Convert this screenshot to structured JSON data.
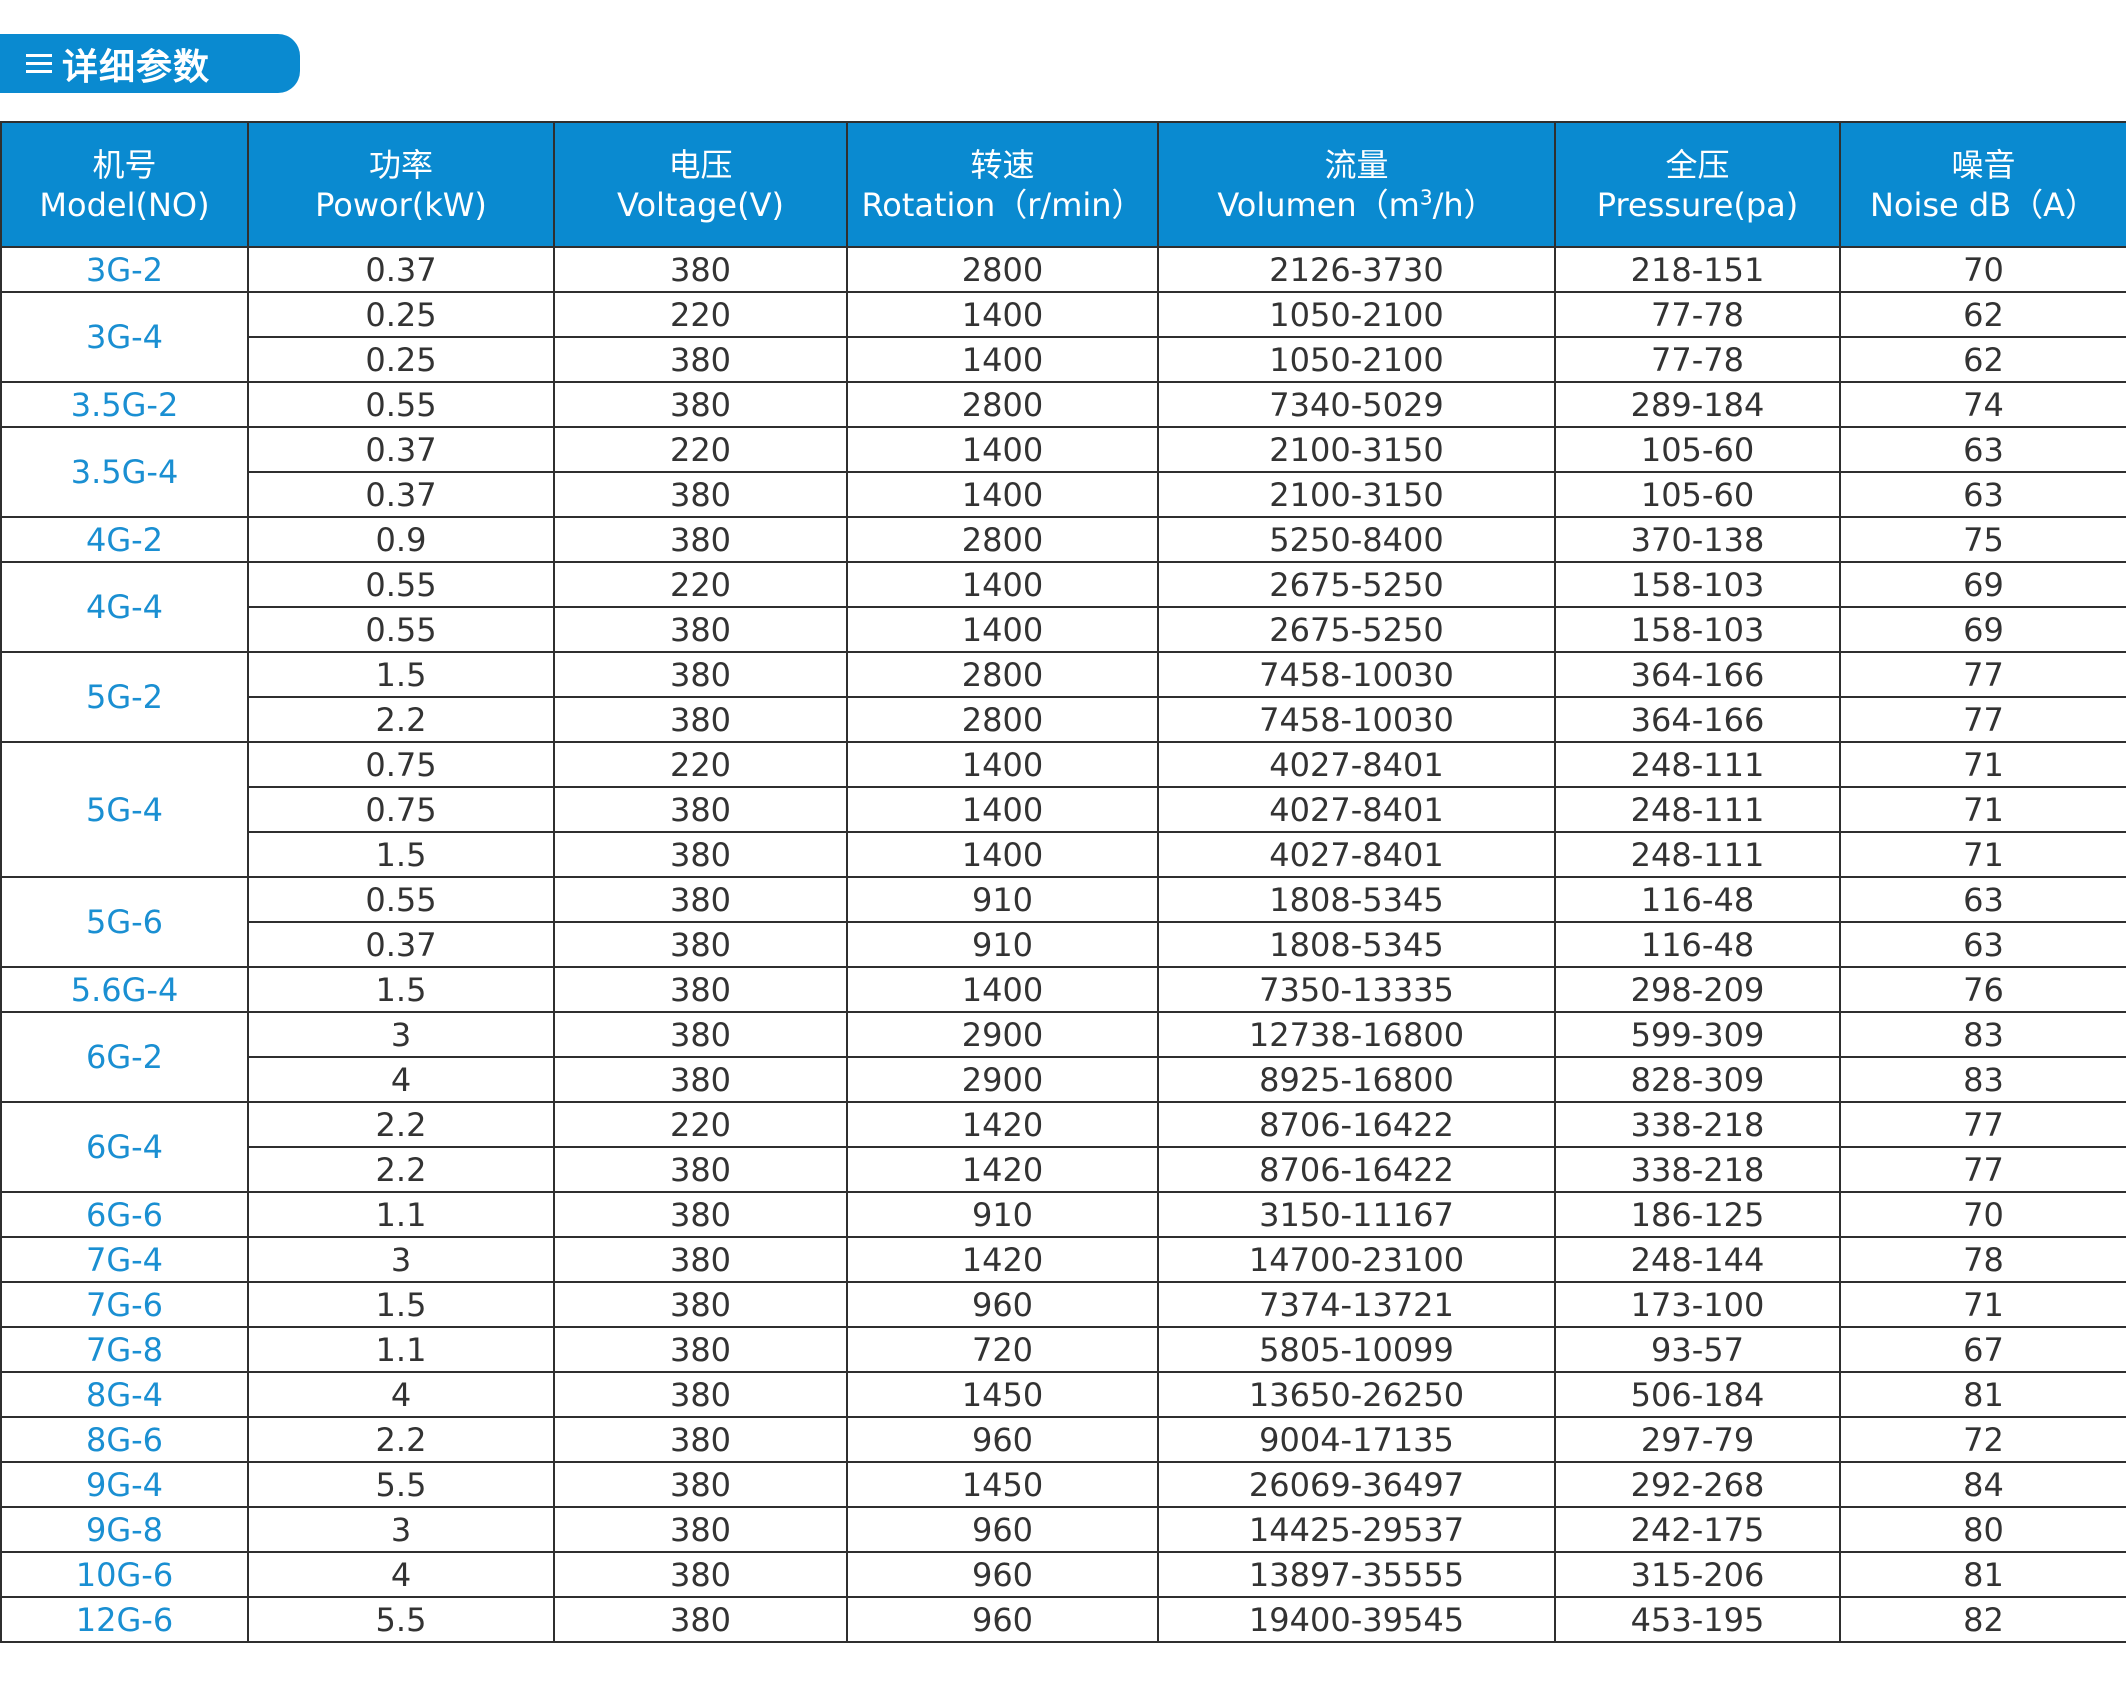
{
  "title": {
    "text": "详细参数",
    "accent_color": "#0a8ad0"
  },
  "columns": [
    {
      "zh": "机号",
      "en": "Model(NO)"
    },
    {
      "zh": "功率",
      "en": "Powor(kW)"
    },
    {
      "zh": "电压",
      "en": "Voltage(V)"
    },
    {
      "zh": "转速",
      "en": "Rotation（r/min）"
    },
    {
      "zh": "流量",
      "en_pre": "Volumen（m",
      "en_sup": "3",
      "en_post": "/h）"
    },
    {
      "zh": "全压",
      "en": "Pressure(pa)"
    },
    {
      "zh": "噪音",
      "en": "Noise dB（A）"
    }
  ],
  "models": [
    {
      "model": "3G-2",
      "rows": [
        [
          "0.37",
          "380",
          "2800",
          "2126-3730",
          "218-151",
          "70"
        ]
      ]
    },
    {
      "model": "3G-4",
      "rows": [
        [
          "0.25",
          "220",
          "1400",
          "1050-2100",
          "77-78",
          "62"
        ],
        [
          "0.25",
          "380",
          "1400",
          "1050-2100",
          "77-78",
          "62"
        ]
      ]
    },
    {
      "model": "3.5G-2",
      "rows": [
        [
          "0.55",
          "380",
          "2800",
          "7340-5029",
          "289-184",
          "74"
        ]
      ]
    },
    {
      "model": "3.5G-4",
      "rows": [
        [
          "0.37",
          "220",
          "1400",
          "2100-3150",
          "105-60",
          "63"
        ],
        [
          "0.37",
          "380",
          "1400",
          "2100-3150",
          "105-60",
          "63"
        ]
      ]
    },
    {
      "model": "4G-2",
      "rows": [
        [
          "0.9",
          "380",
          "2800",
          "5250-8400",
          "370-138",
          "75"
        ]
      ]
    },
    {
      "model": "4G-4",
      "rows": [
        [
          "0.55",
          "220",
          "1400",
          "2675-5250",
          "158-103",
          "69"
        ],
        [
          "0.55",
          "380",
          "1400",
          "2675-5250",
          "158-103",
          "69"
        ]
      ]
    },
    {
      "model": "5G-2",
      "rows": [
        [
          "1.5",
          "380",
          "2800",
          "7458-10030",
          "364-166",
          "77"
        ],
        [
          "2.2",
          "380",
          "2800",
          "7458-10030",
          "364-166",
          "77"
        ]
      ]
    },
    {
      "model": "5G-4",
      "rows": [
        [
          "0.75",
          "220",
          "1400",
          "4027-8401",
          "248-111",
          "71"
        ],
        [
          "0.75",
          "380",
          "1400",
          "4027-8401",
          "248-111",
          "71"
        ],
        [
          "1.5",
          "380",
          "1400",
          "4027-8401",
          "248-111",
          "71"
        ]
      ]
    },
    {
      "model": "5G-6",
      "rows": [
        [
          "0.55",
          "380",
          "910",
          "1808-5345",
          "116-48",
          "63"
        ],
        [
          "0.37",
          "380",
          "910",
          "1808-5345",
          "116-48",
          "63"
        ]
      ]
    },
    {
      "model": "5.6G-4",
      "rows": [
        [
          "1.5",
          "380",
          "1400",
          "7350-13335",
          "298-209",
          "76"
        ]
      ]
    },
    {
      "model": "6G-2",
      "rows": [
        [
          "3",
          "380",
          "2900",
          "12738-16800",
          "599-309",
          "83"
        ],
        [
          "4",
          "380",
          "2900",
          "8925-16800",
          "828-309",
          "83"
        ]
      ]
    },
    {
      "model": "6G-4",
      "rows": [
        [
          "2.2",
          "220",
          "1420",
          "8706-16422",
          "338-218",
          "77"
        ],
        [
          "2.2",
          "380",
          "1420",
          "8706-16422",
          "338-218",
          "77"
        ]
      ]
    },
    {
      "model": "6G-6",
      "rows": [
        [
          "1.1",
          "380",
          "910",
          "3150-11167",
          "186-125",
          "70"
        ]
      ]
    },
    {
      "model": "7G-4",
      "rows": [
        [
          "3",
          "380",
          "1420",
          "14700-23100",
          "248-144",
          "78"
        ]
      ]
    },
    {
      "model": "7G-6",
      "rows": [
        [
          "1.5",
          "380",
          "960",
          "7374-13721",
          "173-100",
          "71"
        ]
      ]
    },
    {
      "model": "7G-8",
      "rows": [
        [
          "1.1",
          "380",
          "720",
          "5805-10099",
          "93-57",
          "67"
        ]
      ]
    },
    {
      "model": "8G-4",
      "rows": [
        [
          "4",
          "380",
          "1450",
          "13650-26250",
          "506-184",
          "81"
        ]
      ]
    },
    {
      "model": "8G-6",
      "rows": [
        [
          "2.2",
          "380",
          "960",
          "9004-17135",
          "297-79",
          "72"
        ]
      ]
    },
    {
      "model": "9G-4",
      "rows": [
        [
          "5.5",
          "380",
          "1450",
          "26069-36497",
          "292-268",
          "84"
        ]
      ]
    },
    {
      "model": "9G-8",
      "rows": [
        [
          "3",
          "380",
          "960",
          "14425-29537",
          "242-175",
          "80"
        ]
      ]
    },
    {
      "model": "10G-6",
      "rows": [
        [
          "4",
          "380",
          "960",
          "13897-35555",
          "315-206",
          "81"
        ]
      ]
    },
    {
      "model": "12G-6",
      "rows": [
        [
          "5.5",
          "380",
          "960",
          "19400-39545",
          "453-195",
          "82"
        ]
      ]
    }
  ]
}
